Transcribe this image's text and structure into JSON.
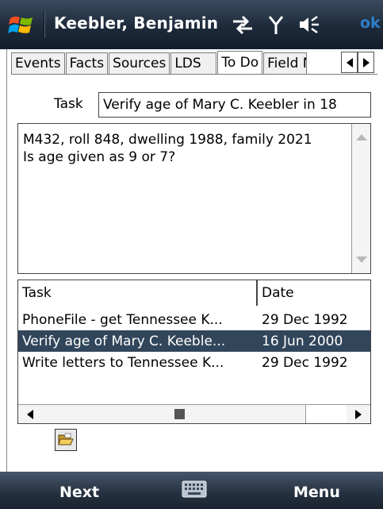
{
  "titlebar": {
    "title": "Keebler, Benjamin Frai",
    "ok_label": "ok",
    "icons": [
      "windows-start-icon",
      "connectivity-icon",
      "signal-antenna-icon",
      "speaker-icon"
    ]
  },
  "tabs": {
    "items": [
      "Events",
      "Facts",
      "Sources",
      "LDS",
      "To Do",
      "Field N"
    ],
    "active": "To Do",
    "scroll_left_icon": "arrow-left-icon",
    "scroll_right_icon": "arrow-right-icon"
  },
  "task_field": {
    "label": "Task",
    "value": "Verify age of Mary C. Keebler in 18"
  },
  "notes": {
    "lines": [
      "M432, roll 848, dwelling 1988, family 2021",
      "Is age given as 9 or 7?"
    ]
  },
  "task_list": {
    "columns": [
      "Task",
      "Date"
    ],
    "rows": [
      {
        "task": "PhoneFile - get Tennessee K...",
        "date": "29 Dec 1992",
        "selected": false
      },
      {
        "task": "Verify age of Mary C. Keeble...",
        "date": "16 Jun 2000",
        "selected": true
      },
      {
        "task": "Write letters to Tennessee K...",
        "date": "29 Dec 1992",
        "selected": false
      }
    ]
  },
  "folder_button": {
    "icon": "open-folder-icon"
  },
  "softkeys": {
    "left": "Next",
    "right": "Menu",
    "center_icon": "keyboard-icon"
  },
  "colors": {
    "titlebar": "#1d2a3a",
    "selection": "#32465b",
    "ok_accent": "#2f7fc9"
  }
}
